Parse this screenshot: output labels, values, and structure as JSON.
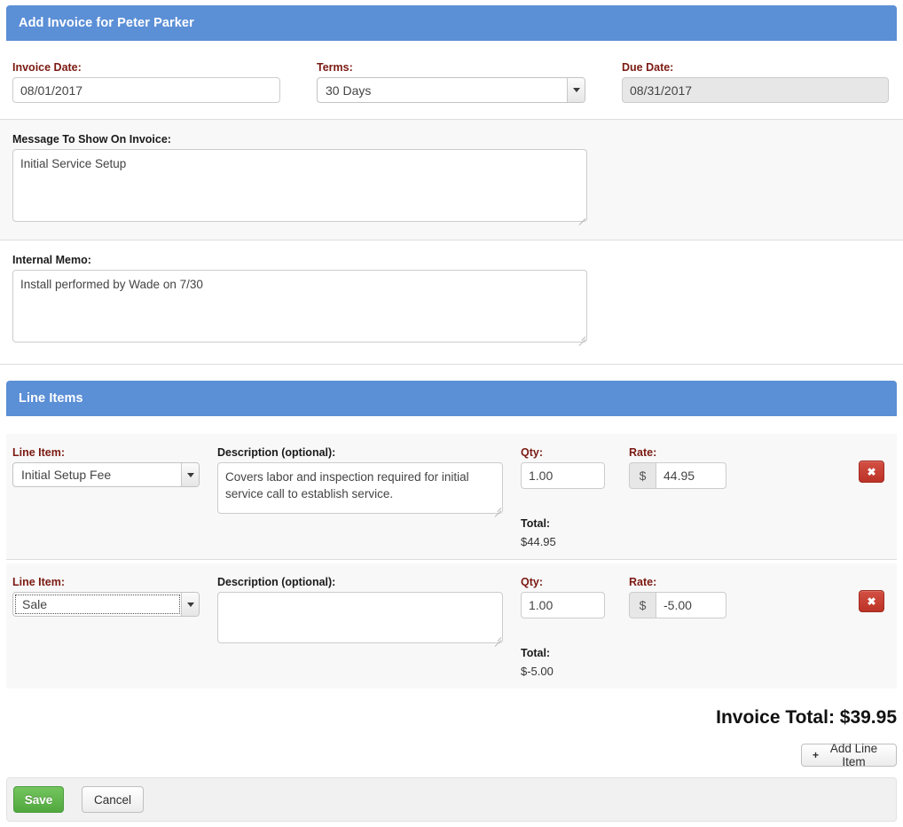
{
  "header": {
    "title": "Add Invoice for Peter Parker"
  },
  "invoice_fields": {
    "invoice_date_label": "Invoice Date:",
    "invoice_date_value": "08/01/2017",
    "terms_label": "Terms:",
    "terms_value": "30 Days",
    "due_date_label": "Due Date:",
    "due_date_value": "08/31/2017"
  },
  "message_block": {
    "label": "Message To Show On Invoice:",
    "value": "Initial Service Setup"
  },
  "memo_block": {
    "label": "Internal Memo:",
    "value": "Install performed by Wade on 7/30"
  },
  "line_items_panel": {
    "title": "Line Items",
    "labels": {
      "line_item": "Line Item:",
      "description": "Description (optional):",
      "qty": "Qty:",
      "rate": "Rate:",
      "total": "Total:",
      "currency_symbol": "$"
    },
    "rows": [
      {
        "line_item": "Initial Setup Fee",
        "description": "Covers labor and inspection required for initial service call to establish service.",
        "qty": "1.00",
        "rate": "44.95",
        "total": "$44.95",
        "delete_label": "✖"
      },
      {
        "line_item": "Sale",
        "description": "",
        "qty": "1.00",
        "rate": "-5.00",
        "total": "$-5.00",
        "delete_label": "✖"
      }
    ]
  },
  "summary": {
    "invoice_total": "Invoice Total: $39.95",
    "add_line_item_label": "Add Line Item",
    "add_line_item_icon": "+"
  },
  "footer": {
    "save_label": "Save",
    "cancel_label": "Cancel"
  },
  "colors": {
    "panel_header": "#5b8fd6",
    "required_label": "#7b1a12",
    "save_button": "#51a83e",
    "delete_button": "#bb3326"
  }
}
